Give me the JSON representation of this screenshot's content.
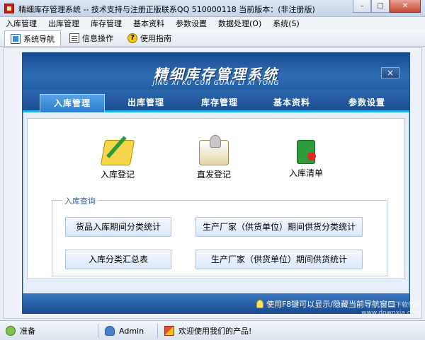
{
  "window": {
    "title": "精细库存管理系统 -- 技术支持与注册正版联系QQ 510000118    当前版本：(非注册版)",
    "minimize": "–",
    "maximize": "□",
    "close": "✕"
  },
  "menubar": [
    "入库管理",
    "出库管理",
    "库存管理",
    "基本资料",
    "参数设置",
    "数据处理(O)",
    "系统(S)"
  ],
  "toolbar": {
    "tabs": [
      {
        "label": "系统导航",
        "icon": "nav-icon"
      },
      {
        "label": "信息操作",
        "icon": "info-icon"
      },
      {
        "label": "使用指南",
        "icon": "help-icon"
      }
    ],
    "help_glyph": "?"
  },
  "panel": {
    "title": "精细库存管理系统",
    "subtitle": "JING XI KU CUN GUAN  LI XI TONG",
    "close": "×",
    "tabs": [
      "入库管理",
      "出库管理",
      "库存管理",
      "基本资料",
      "参数设置"
    ],
    "active_tab": "入库管理",
    "actions": [
      {
        "label": "入库登记",
        "icon": "register-icon"
      },
      {
        "label": "直发登记",
        "icon": "direct-ship-icon"
      },
      {
        "label": "入库清单",
        "icon": "list-icon"
      }
    ],
    "query_group": {
      "legend": "入库查询",
      "buttons": [
        "货品入库期间分类统计",
        "生产厂家（供货单位）期间供货分类统计",
        "入库分类汇总表",
        "生产厂家（供货单位）期间供货统计"
      ]
    },
    "hint": "使用F8键可以显示/隐藏当前导航窗口"
  },
  "statusbar": {
    "ready": "准备",
    "user": "Admin",
    "welcome": "欢迎使用我们的产品!"
  },
  "watermark": {
    "line1": "当下软件园",
    "line2": "www.downxia.com"
  }
}
